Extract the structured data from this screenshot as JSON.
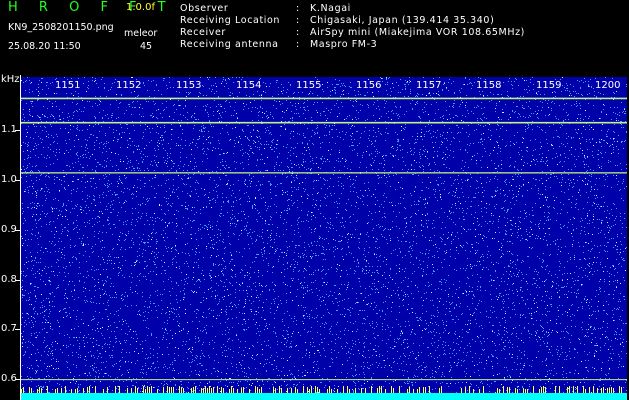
{
  "header": {
    "app_title": "H R O F F T",
    "version": "1.0.0f",
    "filename": "KN9_2508201150.png",
    "timestamp": "25.08.20 11:50",
    "mode_label": "meleor",
    "mode_value": "45",
    "info": [
      {
        "label": "Observer",
        "sep": ":",
        "value": "K.Nagai"
      },
      {
        "label": "Receiving Location",
        "sep": ":",
        "value": "Chigasaki, Japan (139.414 35.340)"
      },
      {
        "label": "Receiver",
        "sep": ":",
        "value": "AirSpy mini (Miakejima VOR 108.65MHz)"
      },
      {
        "label": "Receiving antenna",
        "sep": ":",
        "value": "Maspro FM-3"
      }
    ]
  },
  "waterfall": {
    "y_unit": "kHz",
    "y_ticks": [
      "1.1",
      "1.0",
      "0.9",
      "0.8",
      "0.7",
      "0.6"
    ],
    "x_ticks": [
      "1151",
      "1152",
      "1153",
      "1154",
      "1155",
      "1156",
      "1157",
      "1158",
      "1159",
      "1200"
    ],
    "colors": {
      "background": "#0000aa",
      "noise_light": "#3aa0ff",
      "noise_bright": "#b0ffff",
      "carrier": "#c8ff80",
      "bottom_band": "#00ffff"
    }
  },
  "chart_data": {
    "type": "heatmap",
    "y_unit": "kHz",
    "ylim": [
      0.58,
      1.16
    ],
    "x_ticks": [
      "1151",
      "1152",
      "1153",
      "1154",
      "1155",
      "1156",
      "1157",
      "1158",
      "1159",
      "1200"
    ],
    "y_ticks": [
      1.1,
      1.0,
      0.9,
      0.8,
      0.7,
      0.6
    ],
    "carrier_lines_khz": [
      1.117,
      1.074,
      0.985,
      0.618
    ],
    "grid": false
  }
}
